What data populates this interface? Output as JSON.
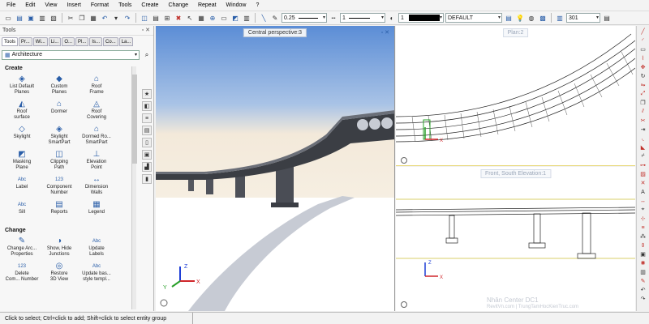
{
  "menu": [
    "File",
    "Edit",
    "View",
    "Insert",
    "Format",
    "Tools",
    "Create",
    "Change",
    "Repeat",
    "Window",
    "?"
  ],
  "toolbar": {
    "pen_thickness": "0.25",
    "line_type": "1",
    "color_number": "1",
    "layer": "DEFAULT",
    "scale_value": "301"
  },
  "tools_panel": {
    "title": "Tools",
    "tabs": [
      "Tools",
      "Pr...",
      "Wi...",
      "Li...",
      "O...",
      "Pl...",
      "Is...",
      "Co...",
      "La..."
    ],
    "category": "Architecture",
    "sections": [
      {
        "name": "Create",
        "items": [
          {
            "label": "List Default\nPlanes",
            "icon": "planes-icon"
          },
          {
            "label": "Custom\nPlanes",
            "icon": "custom-planes-icon"
          },
          {
            "label": "Roof\nFrame",
            "icon": "roof-frame-icon"
          },
          {
            "label": "Roof\nsurface",
            "icon": "roof-surface-icon"
          },
          {
            "label": "Dormer",
            "icon": "dormer-icon"
          },
          {
            "label": "Roof\nCovering",
            "icon": "roof-covering-icon"
          },
          {
            "label": "Skylight",
            "icon": "skylight-icon"
          },
          {
            "label": "Skylight\nSmartPart",
            "icon": "skylight-smartpart-icon"
          },
          {
            "label": "Dormed Ro...\nSmartPart",
            "icon": "dormer-smartpart-icon"
          },
          {
            "label": "Masking\nPlane",
            "icon": "masking-plane-icon"
          },
          {
            "label": "Clipping\nPath",
            "icon": "clipping-path-icon"
          },
          {
            "label": "Elevation\nPoint",
            "icon": "elevation-point-icon"
          },
          {
            "label": "Label",
            "icon": "abc-label-icon"
          },
          {
            "label": "Component\nNumber",
            "icon": "component-number-icon"
          },
          {
            "label": "Dimension\nWalls",
            "icon": "dimension-walls-icon"
          },
          {
            "label": "Sill",
            "icon": "sill-icon"
          },
          {
            "label": "Reports",
            "icon": "reports-icon"
          },
          {
            "label": "Legend",
            "icon": "legend-icon"
          }
        ]
      },
      {
        "name": "Change",
        "items": [
          {
            "label": "Change Arc...\nProperties",
            "icon": "change-properties-icon"
          },
          {
            "label": "Show, Hide\nJunctions",
            "icon": "show-hide-junctions-icon"
          },
          {
            "label": "Update\nLabels",
            "icon": "update-labels-icon"
          },
          {
            "label": "Delete\nCom... Number",
            "icon": "delete-number-icon"
          },
          {
            "label": "Restore\n3D View",
            "icon": "restore-3d-view-icon"
          },
          {
            "label": "Update bas...\nstyle templ...",
            "icon": "update-style-icon"
          }
        ]
      }
    ]
  },
  "viewports": {
    "perspective": "Central perspective:3",
    "plan": "Plan:2",
    "elevation": "Front, South Elevation:1"
  },
  "status": {
    "hint": "Click to select; Ctrl+click to add; Shift+click to select entity group"
  },
  "watermark": {
    "line1": "Nhân Center DC1",
    "line2": "RevitVn.com | TrungTamHocKienTruc.com"
  },
  "colors": {
    "accent": "#2a5ea8",
    "sky_top": "#5b8dd6",
    "sky_horizon": "#f3e9da",
    "bridge_dark": "#3b3e44",
    "axis_x": "#d0262a",
    "axis_y": "#2aa02a",
    "axis_z": "#1f3fd6"
  }
}
